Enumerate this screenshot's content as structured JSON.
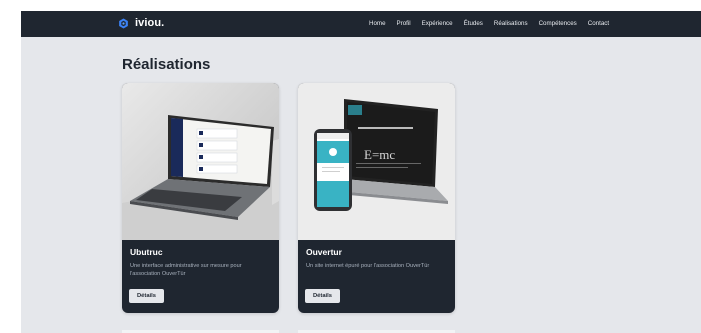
{
  "navbar": {
    "brand": "iviou.",
    "brand_icon": "hexagon-logo-icon",
    "links": [
      "Home",
      "Profil",
      "Expérience",
      "Études",
      "Réalisations",
      "Compétences",
      "Contact"
    ]
  },
  "section": {
    "title": "Réalisations"
  },
  "projects": [
    {
      "title": "Ubutruc",
      "description": "Une interface administrative sur mesure pour l'association OuverTür",
      "button": "Détails"
    },
    {
      "title": "Ouvertur",
      "description": "Un site internet épuré pour l'association OuverTür",
      "button": "Détails"
    }
  ],
  "colors": {
    "navbar": "#1f2630",
    "page_background": "#e5e7eb",
    "card_background": "#1f2630",
    "brand_icon": "#3b82f6"
  }
}
